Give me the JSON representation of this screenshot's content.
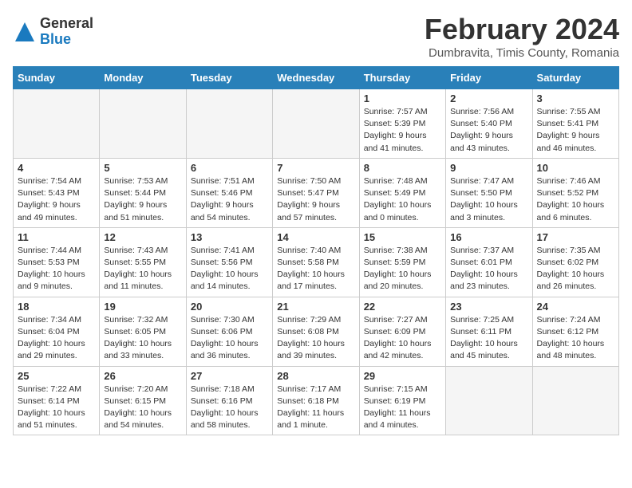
{
  "header": {
    "logo_general": "General",
    "logo_blue": "Blue",
    "title": "February 2024",
    "subtitle": "Dumbravita, Timis County, Romania"
  },
  "days_of_week": [
    "Sunday",
    "Monday",
    "Tuesday",
    "Wednesday",
    "Thursday",
    "Friday",
    "Saturday"
  ],
  "weeks": [
    [
      {
        "day": "",
        "info": "",
        "empty": true
      },
      {
        "day": "",
        "info": "",
        "empty": true
      },
      {
        "day": "",
        "info": "",
        "empty": true
      },
      {
        "day": "",
        "info": "",
        "empty": true
      },
      {
        "day": "1",
        "info": "Sunrise: 7:57 AM\nSunset: 5:39 PM\nDaylight: 9 hours\nand 41 minutes.",
        "empty": false
      },
      {
        "day": "2",
        "info": "Sunrise: 7:56 AM\nSunset: 5:40 PM\nDaylight: 9 hours\nand 43 minutes.",
        "empty": false
      },
      {
        "day": "3",
        "info": "Sunrise: 7:55 AM\nSunset: 5:41 PM\nDaylight: 9 hours\nand 46 minutes.",
        "empty": false
      }
    ],
    [
      {
        "day": "4",
        "info": "Sunrise: 7:54 AM\nSunset: 5:43 PM\nDaylight: 9 hours\nand 49 minutes.",
        "empty": false
      },
      {
        "day": "5",
        "info": "Sunrise: 7:53 AM\nSunset: 5:44 PM\nDaylight: 9 hours\nand 51 minutes.",
        "empty": false
      },
      {
        "day": "6",
        "info": "Sunrise: 7:51 AM\nSunset: 5:46 PM\nDaylight: 9 hours\nand 54 minutes.",
        "empty": false
      },
      {
        "day": "7",
        "info": "Sunrise: 7:50 AM\nSunset: 5:47 PM\nDaylight: 9 hours\nand 57 minutes.",
        "empty": false
      },
      {
        "day": "8",
        "info": "Sunrise: 7:48 AM\nSunset: 5:49 PM\nDaylight: 10 hours\nand 0 minutes.",
        "empty": false
      },
      {
        "day": "9",
        "info": "Sunrise: 7:47 AM\nSunset: 5:50 PM\nDaylight: 10 hours\nand 3 minutes.",
        "empty": false
      },
      {
        "day": "10",
        "info": "Sunrise: 7:46 AM\nSunset: 5:52 PM\nDaylight: 10 hours\nand 6 minutes.",
        "empty": false
      }
    ],
    [
      {
        "day": "11",
        "info": "Sunrise: 7:44 AM\nSunset: 5:53 PM\nDaylight: 10 hours\nand 9 minutes.",
        "empty": false
      },
      {
        "day": "12",
        "info": "Sunrise: 7:43 AM\nSunset: 5:55 PM\nDaylight: 10 hours\nand 11 minutes.",
        "empty": false
      },
      {
        "day": "13",
        "info": "Sunrise: 7:41 AM\nSunset: 5:56 PM\nDaylight: 10 hours\nand 14 minutes.",
        "empty": false
      },
      {
        "day": "14",
        "info": "Sunrise: 7:40 AM\nSunset: 5:58 PM\nDaylight: 10 hours\nand 17 minutes.",
        "empty": false
      },
      {
        "day": "15",
        "info": "Sunrise: 7:38 AM\nSunset: 5:59 PM\nDaylight: 10 hours\nand 20 minutes.",
        "empty": false
      },
      {
        "day": "16",
        "info": "Sunrise: 7:37 AM\nSunset: 6:01 PM\nDaylight: 10 hours\nand 23 minutes.",
        "empty": false
      },
      {
        "day": "17",
        "info": "Sunrise: 7:35 AM\nSunset: 6:02 PM\nDaylight: 10 hours\nand 26 minutes.",
        "empty": false
      }
    ],
    [
      {
        "day": "18",
        "info": "Sunrise: 7:34 AM\nSunset: 6:04 PM\nDaylight: 10 hours\nand 29 minutes.",
        "empty": false
      },
      {
        "day": "19",
        "info": "Sunrise: 7:32 AM\nSunset: 6:05 PM\nDaylight: 10 hours\nand 33 minutes.",
        "empty": false
      },
      {
        "day": "20",
        "info": "Sunrise: 7:30 AM\nSunset: 6:06 PM\nDaylight: 10 hours\nand 36 minutes.",
        "empty": false
      },
      {
        "day": "21",
        "info": "Sunrise: 7:29 AM\nSunset: 6:08 PM\nDaylight: 10 hours\nand 39 minutes.",
        "empty": false
      },
      {
        "day": "22",
        "info": "Sunrise: 7:27 AM\nSunset: 6:09 PM\nDaylight: 10 hours\nand 42 minutes.",
        "empty": false
      },
      {
        "day": "23",
        "info": "Sunrise: 7:25 AM\nSunset: 6:11 PM\nDaylight: 10 hours\nand 45 minutes.",
        "empty": false
      },
      {
        "day": "24",
        "info": "Sunrise: 7:24 AM\nSunset: 6:12 PM\nDaylight: 10 hours\nand 48 minutes.",
        "empty": false
      }
    ],
    [
      {
        "day": "25",
        "info": "Sunrise: 7:22 AM\nSunset: 6:14 PM\nDaylight: 10 hours\nand 51 minutes.",
        "empty": false
      },
      {
        "day": "26",
        "info": "Sunrise: 7:20 AM\nSunset: 6:15 PM\nDaylight: 10 hours\nand 54 minutes.",
        "empty": false
      },
      {
        "day": "27",
        "info": "Sunrise: 7:18 AM\nSunset: 6:16 PM\nDaylight: 10 hours\nand 58 minutes.",
        "empty": false
      },
      {
        "day": "28",
        "info": "Sunrise: 7:17 AM\nSunset: 6:18 PM\nDaylight: 11 hours\nand 1 minute.",
        "empty": false
      },
      {
        "day": "29",
        "info": "Sunrise: 7:15 AM\nSunset: 6:19 PM\nDaylight: 11 hours\nand 4 minutes.",
        "empty": false
      },
      {
        "day": "",
        "info": "",
        "empty": true
      },
      {
        "day": "",
        "info": "",
        "empty": true
      }
    ]
  ]
}
